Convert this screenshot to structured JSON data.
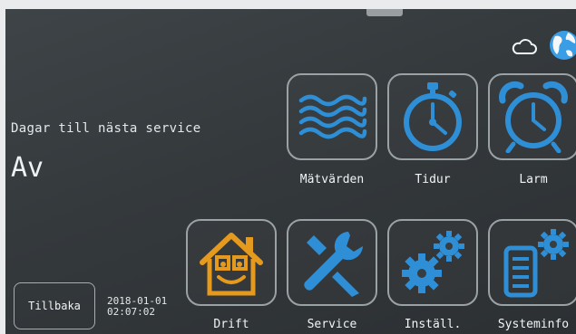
{
  "status": {
    "cloud_icon": "cloud-icon",
    "globe_icon": "globe-icon"
  },
  "service": {
    "label": "Dagar till nästa service",
    "value": "Av"
  },
  "tiles": [
    {
      "label": "Mätvärden",
      "icon": "waves-icon",
      "color": "#2f8fd6"
    },
    {
      "label": "Tidur",
      "icon": "stopwatch-icon",
      "color": "#2f8fd6"
    },
    {
      "label": "Larm",
      "icon": "alarm-clock-icon",
      "color": "#2f8fd6"
    },
    {
      "label": "Drift",
      "icon": "house-face-icon",
      "color": "#e59a1d"
    },
    {
      "label": "Service",
      "icon": "wrench-icon",
      "color": "#2f8fd6"
    },
    {
      "label": "Inställ.",
      "icon": "gears-icon",
      "color": "#2f8fd6"
    },
    {
      "label": "Systeminfo",
      "icon": "device-gear-icon",
      "color": "#2f8fd6"
    }
  ],
  "back_button": {
    "label": "Tillbaka"
  },
  "datetime": {
    "date": "2018-01-01",
    "time": "02:07:02"
  }
}
